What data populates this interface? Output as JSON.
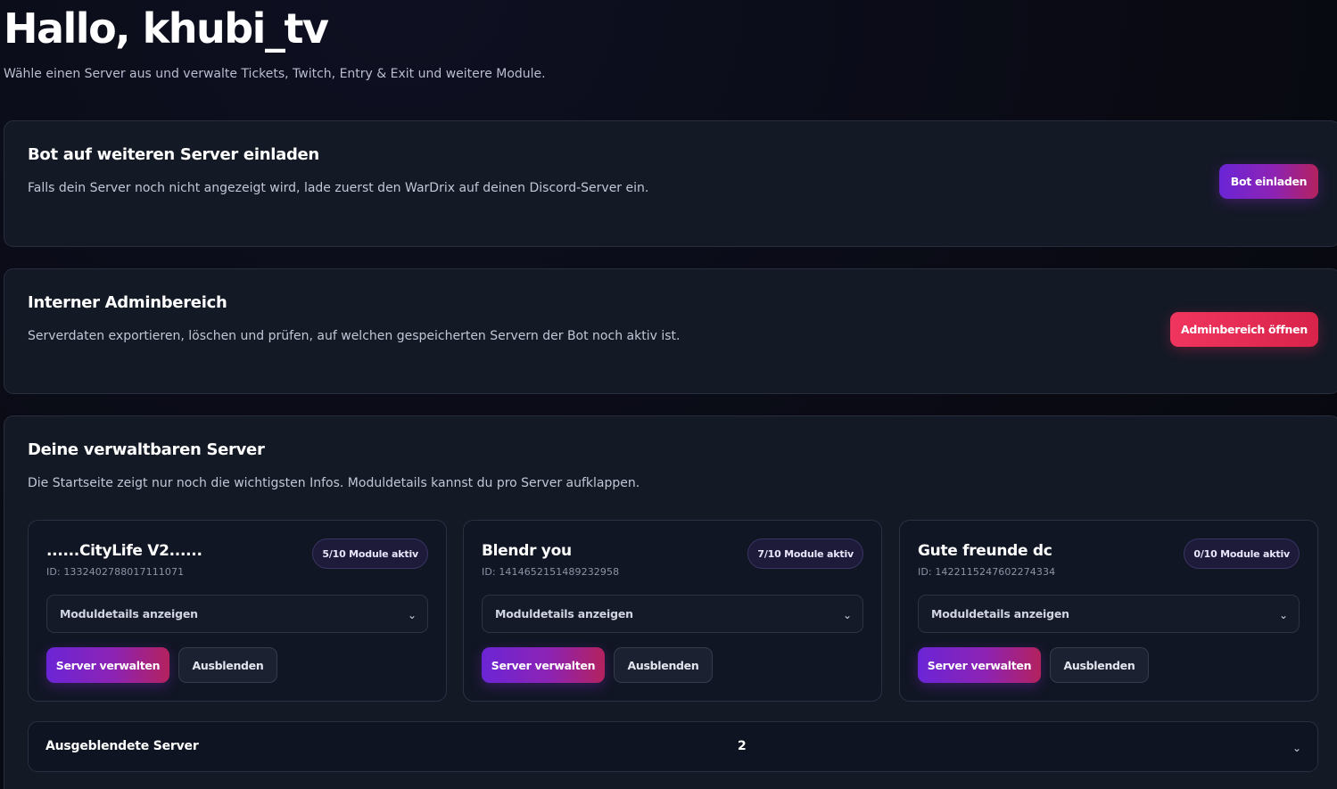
{
  "header": {
    "title": "Hallo, khubi_tv",
    "subtitle": "Wähle einen Server aus und verwalte Tickets, Twitch, Entry & Exit und weitere Module."
  },
  "invite_card": {
    "title": "Bot auf weiteren Server einladen",
    "text": "Falls dein Server noch nicht angezeigt wird, lade zuerst den WarDrix auf deinen Discord-Server ein.",
    "button_label": "Bot einladen"
  },
  "admin_card": {
    "title": "Interner Adminbereich",
    "text": "Serverdaten exportieren, löschen und prüfen, auf welchen gespeicherten Servern der Bot noch aktiv ist.",
    "button_label": "Adminbereich öffnen"
  },
  "servers_section": {
    "title": "Deine verwaltbaren Server",
    "text": "Die Startseite zeigt nur noch die wichtigsten Infos. Moduldetails kannst du pro Server aufklappen.",
    "servers": [
      {
        "name": "......CityLife V2......",
        "id": "ID: 1332402788017111071",
        "modules_badge": "5/10 Module aktiv",
        "details_label": "Moduldetails anzeigen",
        "manage_label": "Server verwalten",
        "hide_label": "Ausblenden"
      },
      {
        "name": "Blendr you",
        "id": "ID: 1414652151489232958",
        "modules_badge": "7/10 Module aktiv",
        "details_label": "Moduldetails anzeigen",
        "manage_label": "Server verwalten",
        "hide_label": "Ausblenden"
      },
      {
        "name": "Gute freunde dc",
        "id": "ID: 1422115247602274334",
        "modules_badge": "0/10 Module aktiv",
        "details_label": "Moduldetails anzeigen",
        "manage_label": "Server verwalten",
        "hide_label": "Ausblenden"
      }
    ],
    "hidden_servers": {
      "label": "Ausgeblendete Server",
      "count": "2"
    }
  },
  "icons": {
    "chevron": "chevron-down-icon"
  },
  "colors": {
    "background": "#090a12",
    "card": "#141926",
    "accent_purple": "#6b25d6",
    "accent_red": "#f0355e"
  }
}
